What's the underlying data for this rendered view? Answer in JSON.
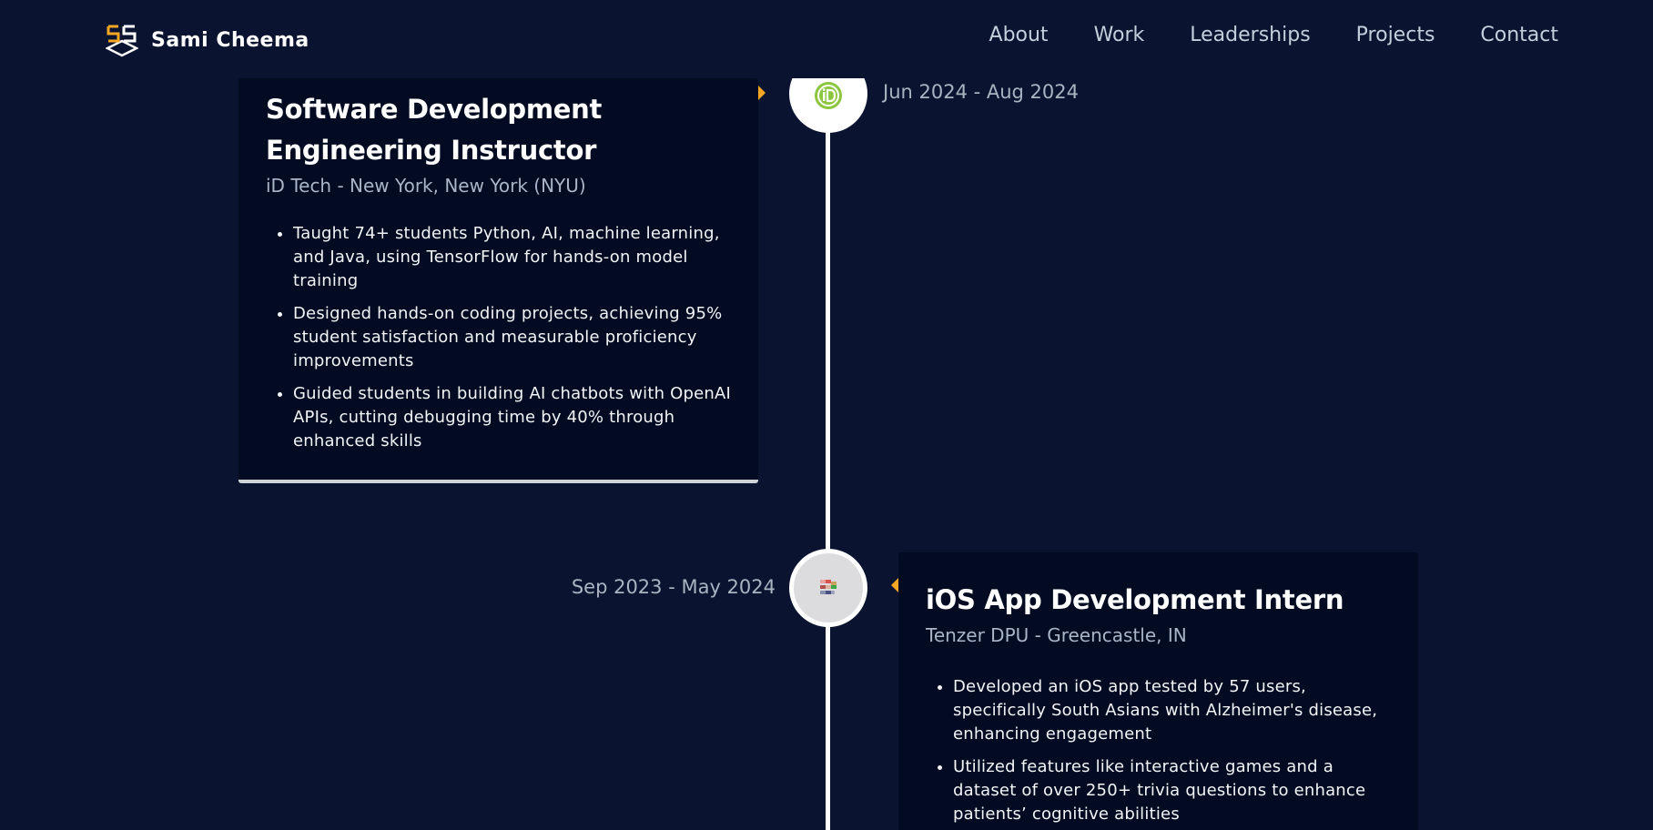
{
  "nav": {
    "brand": "Sami Cheema",
    "links": [
      "About",
      "Work",
      "Leaderships",
      "Projects",
      "Contact"
    ]
  },
  "experiences": [
    {
      "title": "Software Development Engineering Instructor",
      "company": "iD Tech - New York, New York (NYU)",
      "date": "Jun 2024 - Aug 2024",
      "icon": "id-tech-logo",
      "points": [
        "Taught 74+ students Python, AI, machine learning, and Java, using TensorFlow for hands-on model training",
        "Designed hands-on coding projects, achieving 95% student satisfaction and measurable proficiency improvements",
        "Guided students in building AI chatbots with OpenAI APIs, cutting debugging time by 40% through enhanced skills"
      ]
    },
    {
      "title": "iOS App Development Intern",
      "company": "Tenzer DPU - Greencastle, IN",
      "date": "Sep 2023 - May 2024",
      "icon": "tenzer-dpu-logo",
      "points": [
        "Developed an iOS app tested by 57 users, specifically South Asians with Alzheimer's disease, enhancing engagement",
        "Utilized features like interactive games and a dataset of over 250+ trivia questions to enhance patients’ cognitive abilities"
      ]
    }
  ],
  "colors": {
    "background": "#0a1430",
    "card": "#020b21",
    "accent": "#f5a623",
    "idtech_green": "#8cc63f"
  }
}
